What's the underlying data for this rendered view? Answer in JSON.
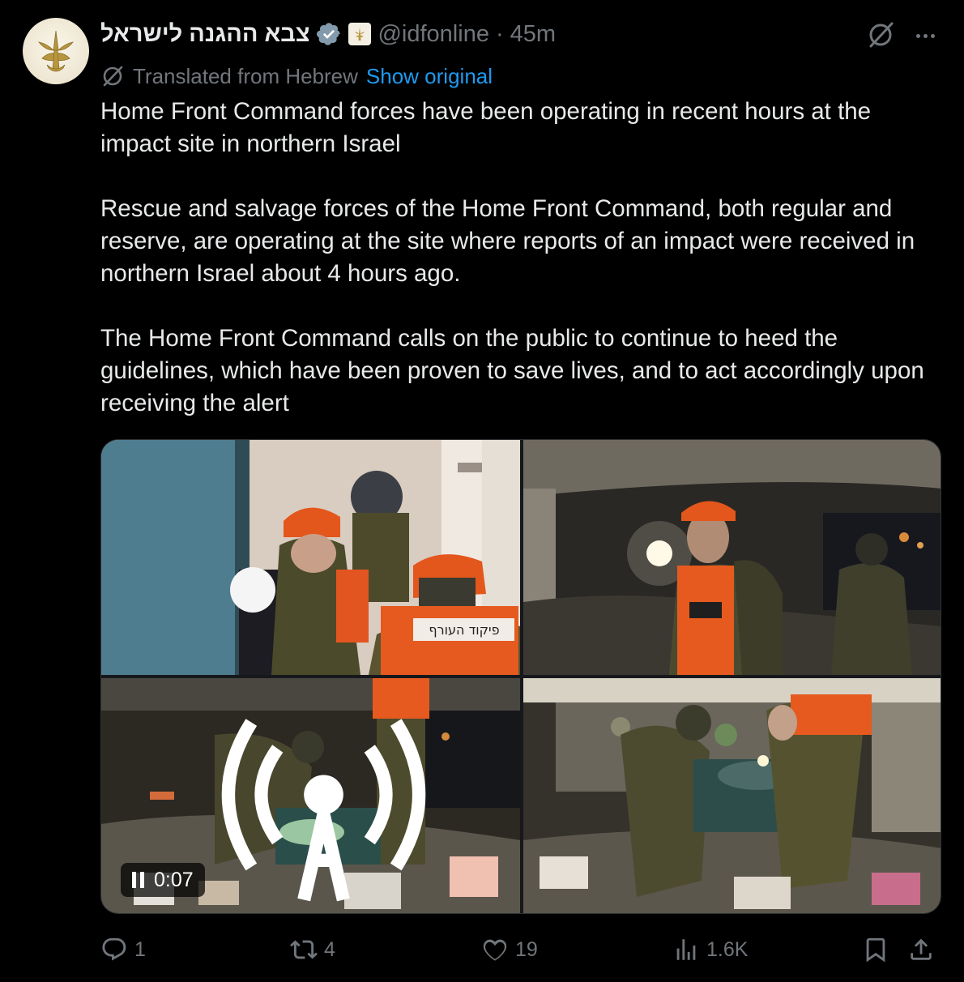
{
  "author": {
    "display_name": "צבא ההגנה לישראל",
    "handle": "@idfonline",
    "separator": "·",
    "time": "45m"
  },
  "translation": {
    "label": "Translated from Hebrew",
    "show_original": "Show original"
  },
  "tweet": {
    "paragraphs": [
      "Home Front Command forces have been operating in recent hours at the impact site in northern Israel",
      "Rescue and salvage forces of the Home Front Command, both regular and reserve, are operating at the site where reports of an impact were received in northern Israel about 4 hours ago.",
      "The Home Front Command calls on the public to continue to heed the guidelines, which have been proven to save lives, and to act accordingly upon receiving the alert"
    ]
  },
  "media": {
    "video_time": "0:07",
    "vest_text": "פיקוד העורף"
  },
  "actions": {
    "replies": "1",
    "reposts": "4",
    "likes": "19",
    "views": "1.6K"
  },
  "colors": {
    "background": "#000000",
    "text": "#e7e9ea",
    "muted": "#71767b",
    "link": "#1d9bf0",
    "verified": "#829aab"
  },
  "icons": [
    "idf-emblem-icon",
    "verified-badge-icon",
    "flag-emblem-icon",
    "grok-icon",
    "more-icon",
    "translate-icon",
    "pause-icon",
    "broadcast-icon",
    "reply-icon",
    "repost-icon",
    "like-icon",
    "views-icon",
    "bookmark-icon",
    "share-icon"
  ]
}
